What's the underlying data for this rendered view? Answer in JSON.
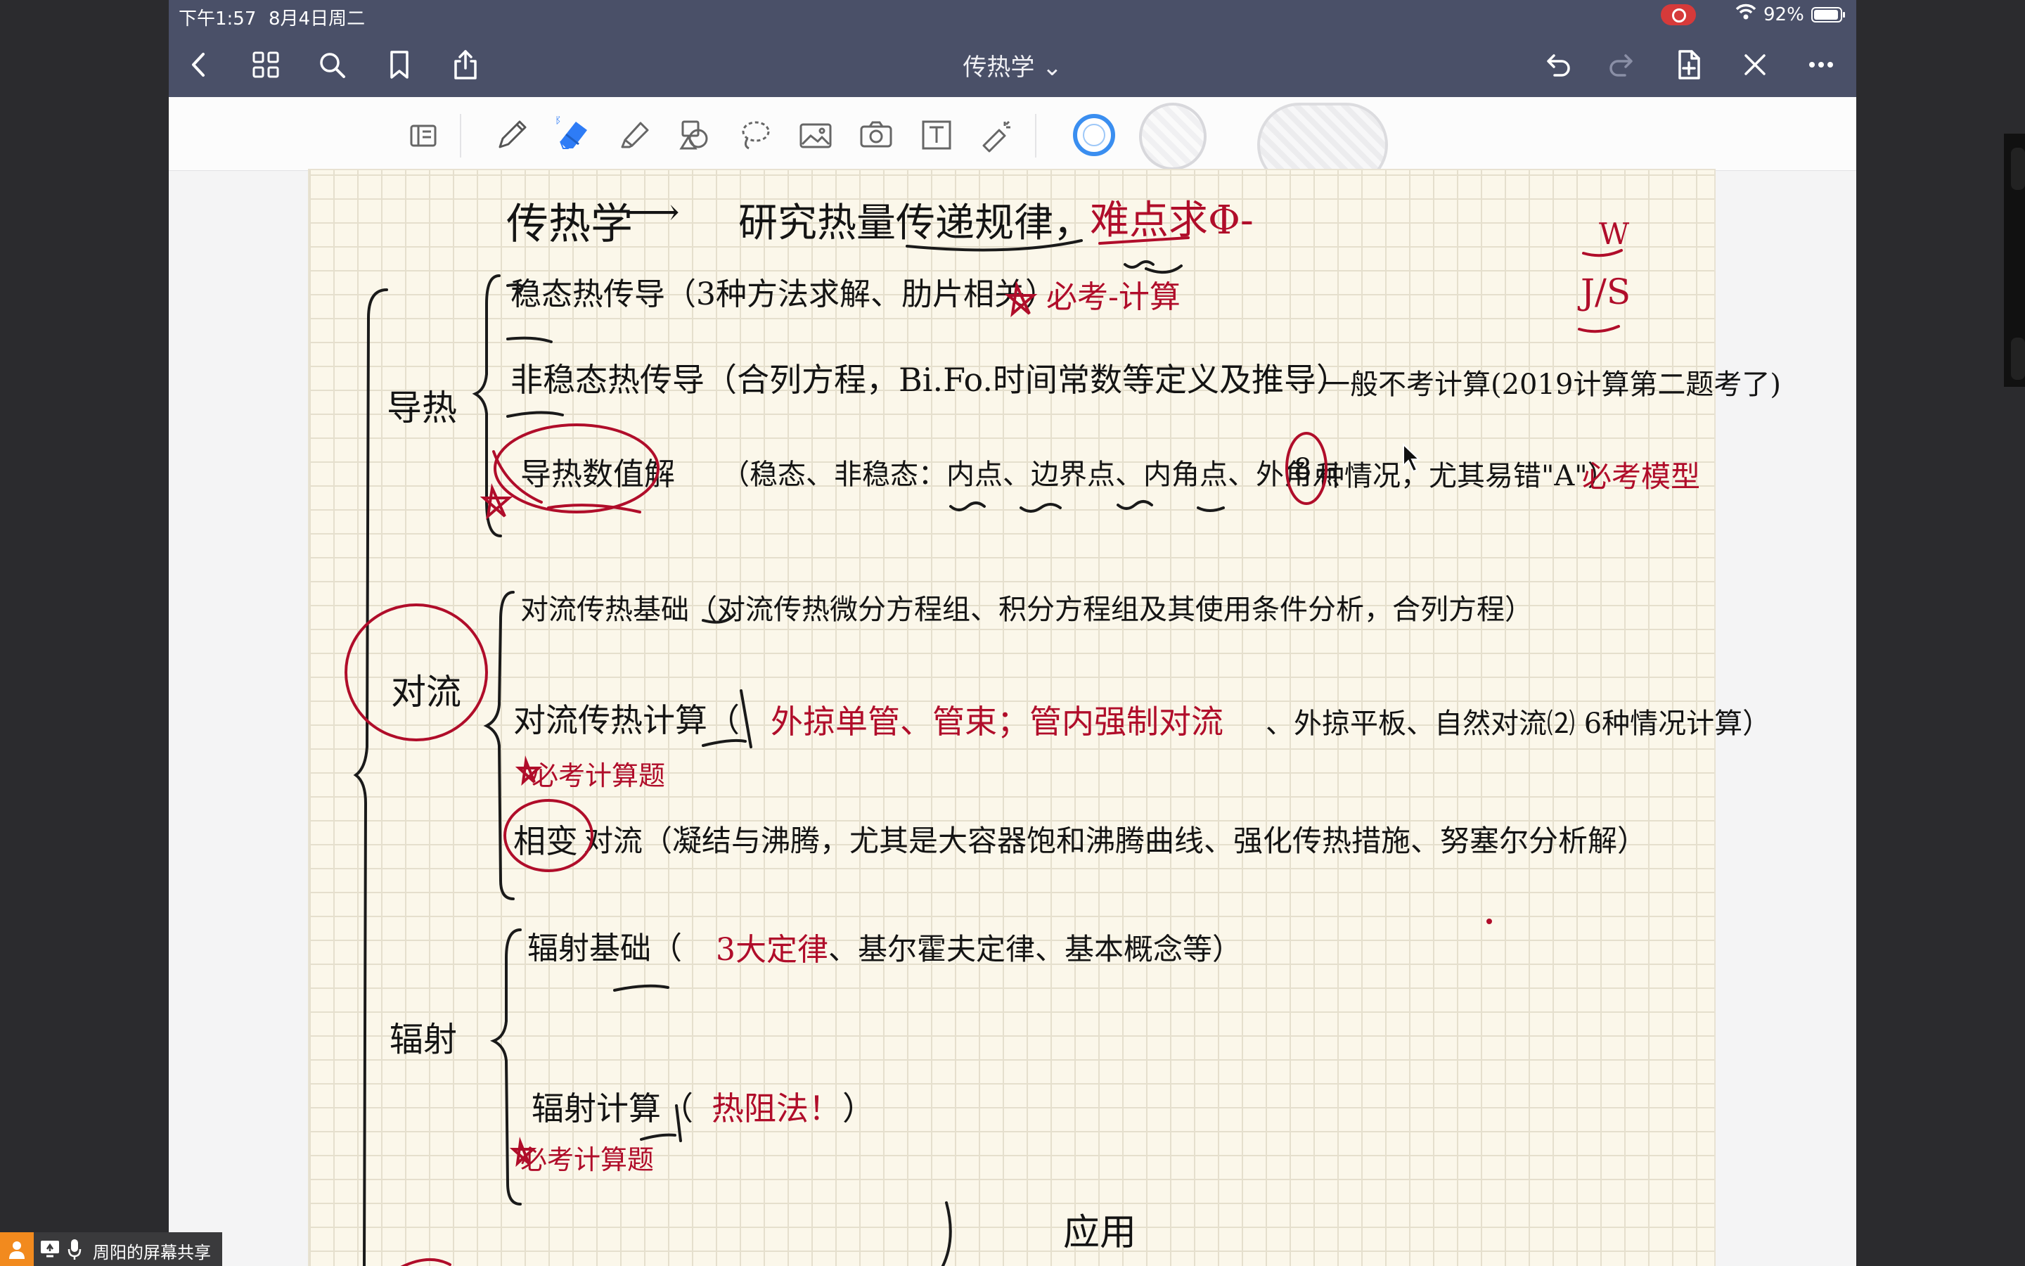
{
  "status_bar": {
    "time": "下午1:57",
    "date": "8月4日周二",
    "battery": "92%"
  },
  "nav_bar": {
    "document_title": "传热学 ⌄"
  },
  "toolbar": {
    "tools": [
      "page-layout-icon",
      "pen-icon",
      "eraser-icon",
      "highlighter-icon",
      "shapes-icon",
      "lasso-icon",
      "image-icon",
      "camera-icon",
      "text-box-icon",
      "laser-pointer-icon"
    ],
    "selected_tool": "eraser-icon",
    "colors": {
      "ring": "#3a8ef0",
      "ink_black": "#141414",
      "ink_red": "#b00d2a"
    }
  },
  "notes": {
    "title_left": "传热学",
    "title_arrow": "⟶",
    "title_right": "研究热量传递规律，",
    "title_red": "难点求Φ-",
    "unit_top": "W",
    "unit_bottom": "J/S",
    "conduction": {
      "label": "导热",
      "row1": "稳态热传导（3种方法求解、肋片相关）",
      "row1_red": "必考-计算",
      "row2": "非稳态热传导（合列方程，Bi.Fo.时间常数等定义及推导）",
      "row2_note": "一般不考计算(2019计算第二题考了)",
      "row3_circled": "导热数值解",
      "row3": "（稳态、非稳态：内点、边界点、内角点、外角点",
      "row3_circled_8": "8",
      "row3_tail": "种情况，尤其易错\"A\"）",
      "row3_red": "必考模型"
    },
    "convection": {
      "label": "对流",
      "row1": "对流传热基础（对流传热微分方程组、积分方程组及其使用条件分析，合列方程）",
      "row2_a": "对流传热计算（",
      "row2_red": "外掠单管、管束；管内强制对流",
      "row2_b": "、外掠平板、自然对流⑵ 6种情况计算）",
      "row2_note": "必考计算题",
      "row3_circled": "相变",
      "row3": "对流（凝结与沸腾，尤其是大容器饱和沸腾曲线、强化传热措施、努塞尔分析解）"
    },
    "radiation": {
      "label": "辐射",
      "row1_a": "辐射基础（",
      "row1_red": "3大定律",
      "row1_b": "、基尔霍夫定律、基本概念等）",
      "row2_a": "辐射计算（",
      "row2_red": "热阻法！",
      "row2_b": "）",
      "row2_note": "必考计算题"
    },
    "bottom_fragment": "应用"
  },
  "screen_share": {
    "label": "周阳的屏幕共享"
  }
}
